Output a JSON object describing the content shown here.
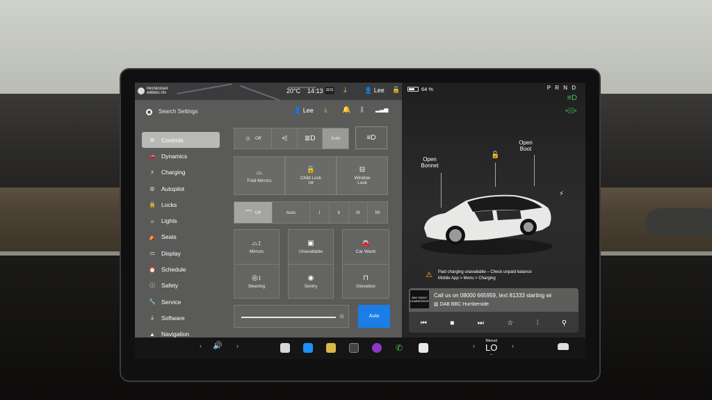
{
  "status": {
    "airbag_label": "PASSENGER AIRBAG ON",
    "temperature": "20°C",
    "time": "14:13",
    "sos": "SOS",
    "user": "Lee",
    "battery_percent": "64 %",
    "gear": "P R N D"
  },
  "settings_header": {
    "search_placeholder": "Search Settings",
    "user": "Lee"
  },
  "sidebar": {
    "items": [
      {
        "label": "Controls",
        "icon": "toggle-icon",
        "active": true
      },
      {
        "label": "Dynamics",
        "icon": "car-icon"
      },
      {
        "label": "Charging",
        "icon": "bolt-icon"
      },
      {
        "label": "Autopilot",
        "icon": "steering-icon"
      },
      {
        "label": "Locks",
        "icon": "lock-icon"
      },
      {
        "label": "Lights",
        "icon": "sun-icon"
      },
      {
        "label": "Seats",
        "icon": "seat-icon"
      },
      {
        "label": "Display",
        "icon": "display-icon"
      },
      {
        "label": "Schedule",
        "icon": "clock-icon"
      },
      {
        "label": "Safety",
        "icon": "info-icon"
      },
      {
        "label": "Service",
        "icon": "wrench-icon"
      },
      {
        "label": "Software",
        "icon": "download-icon"
      },
      {
        "label": "Navigation",
        "icon": "navigation-icon"
      }
    ]
  },
  "controls": {
    "lights_off": "Off",
    "lights_auto": "Auto",
    "fold_mirrors": "Fold Mirrors",
    "child_lock": "Child Lock",
    "child_lock_state": "Off",
    "window_lock": "Window Lock",
    "wiper_off": "Off",
    "wiper_auto": "Auto",
    "wiper_speeds": [
      "I",
      "II",
      "III",
      "IIII"
    ],
    "mirrors": "Mirrors",
    "unavailable": "Unavailable",
    "car_wash": "Car Wash",
    "steering": "Steering",
    "sentry": "Sentry",
    "glovebox": "Glovebox",
    "brightness_auto": "Auto"
  },
  "vehicle": {
    "open_bonnet": "Open Bonnet",
    "open_boot": "Open Boot",
    "alert_line1": "Paid charging unavailable – Check unpaid balance",
    "alert_line2": "Mobile App > Menu > Charging"
  },
  "media": {
    "station_logo": "BBC RADIO HUMBERSIDE",
    "now_playing": "Call us on 08000 665959, text 81333 starting wi",
    "station": "DAB BBC Humberside"
  },
  "taskbar": {
    "climate_mode": "Manual",
    "climate_temp": "LO"
  },
  "colors": {
    "accent_blue": "#1a7de8",
    "indicator_green": "#3fc84a",
    "warning_yellow": "#f0c020"
  }
}
